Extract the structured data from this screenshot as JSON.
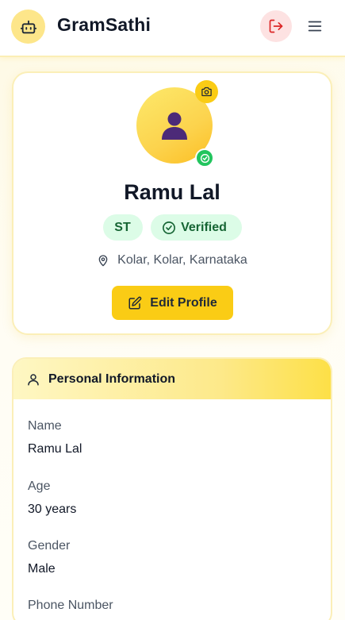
{
  "header": {
    "app_title": "GramSathi",
    "logo_icon": "robot-icon",
    "logout_icon": "logout-icon",
    "menu_icon": "hamburger-menu-icon"
  },
  "profile": {
    "name": "Ramu Lal",
    "category_badge": "ST",
    "verified_badge": "Verified",
    "location": "Kolar, Kolar, Karnataka",
    "edit_button": "Edit Profile"
  },
  "personal_info": {
    "section_title": "Personal Information",
    "fields": [
      {
        "label": "Name",
        "value": "Ramu Lal"
      },
      {
        "label": "Age",
        "value": "30 years"
      },
      {
        "label": "Gender",
        "value": "Male"
      },
      {
        "label": "Phone Number",
        "value": ""
      }
    ]
  },
  "colors": {
    "accent": "#facc15",
    "verified_green": "#22c55e",
    "badge_bg": "#dcfce7",
    "logout_red": "#dc2626"
  }
}
